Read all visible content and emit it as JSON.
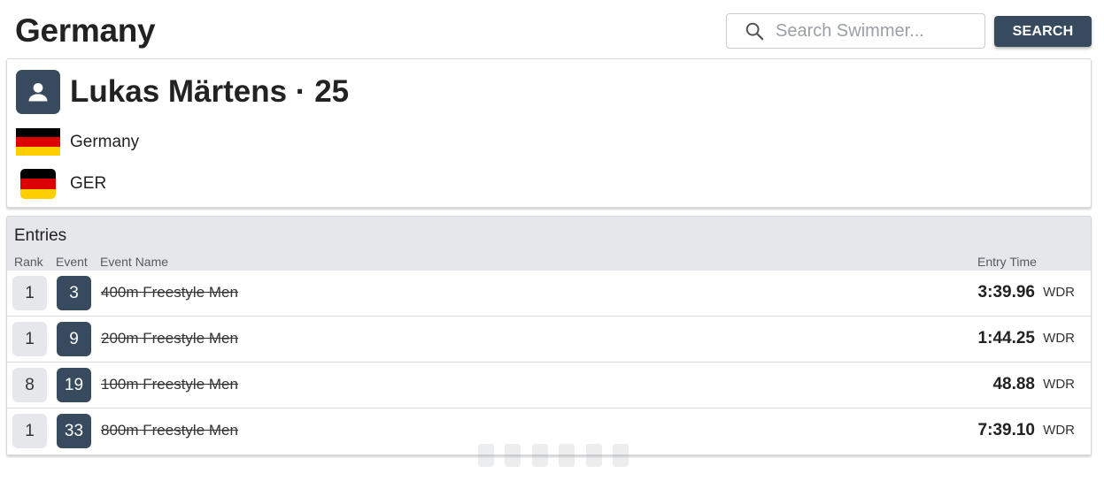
{
  "header": {
    "title": "Germany",
    "search_placeholder": "Search Swimmer...",
    "search_button": "SEARCH"
  },
  "profile": {
    "name_line": "Lukas Märtens · 25",
    "country": "Germany",
    "country_code": "GER",
    "flag_colors": [
      "#000000",
      "#dd0000",
      "#ffce00"
    ]
  },
  "entries": {
    "title": "Entries",
    "columns": {
      "rank": "Rank",
      "event": "Event",
      "event_name": "Event Name",
      "entry_time": "Entry Time"
    },
    "rows": [
      {
        "rank": "1",
        "event": "3",
        "name": "400m Freestyle Men",
        "time": "3:39.96",
        "unit": "WDR"
      },
      {
        "rank": "1",
        "event": "9",
        "name": "200m Freestyle Men",
        "time": "1:44.25",
        "unit": "WDR"
      },
      {
        "rank": "8",
        "event": "19",
        "name": "100m Freestyle Men",
        "time": "48.88",
        "unit": "WDR"
      },
      {
        "rank": "1",
        "event": "33",
        "name": "800m Freestyle Men",
        "time": "7:39.10",
        "unit": "WDR"
      }
    ]
  },
  "colors": {
    "primary": "#374a5e",
    "chip_bg": "#e6e7eb"
  }
}
